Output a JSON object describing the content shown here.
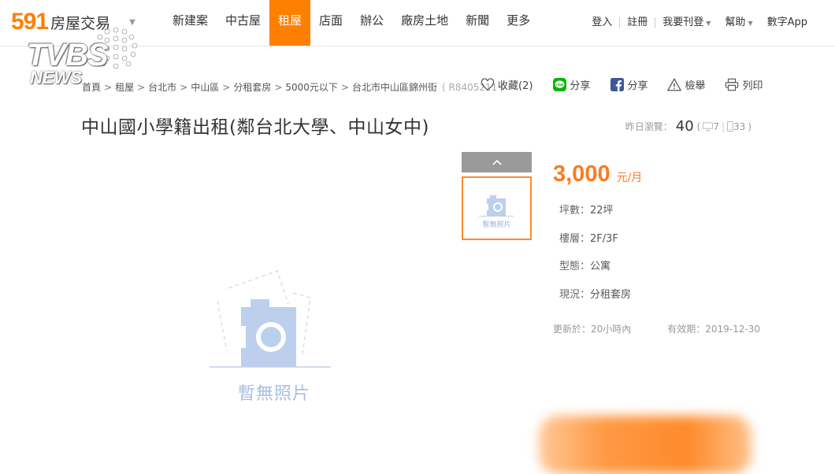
{
  "header": {
    "logo_num": "591",
    "logo_text": "房屋交易",
    "nav": [
      {
        "label": "新建案",
        "active": false
      },
      {
        "label": "中古屋",
        "active": false
      },
      {
        "label": "租屋",
        "active": true
      },
      {
        "label": "店面",
        "active": false
      },
      {
        "label": "辦公",
        "active": false
      },
      {
        "label": "廠房土地",
        "active": false
      },
      {
        "label": "新聞",
        "active": false
      },
      {
        "label": "更多",
        "active": false
      }
    ],
    "right": {
      "login": "登入",
      "register": "註冊",
      "post": "我要刊登",
      "help": "幫助",
      "app": "數字App"
    }
  },
  "watermark": {
    "main": "TVBS",
    "sub": "NEWS"
  },
  "breadcrumb": {
    "items": [
      "首頁",
      "租屋",
      "台北市",
      "中山區",
      "分租套房",
      "5000元以下",
      "台北市中山區錦州街"
    ],
    "code": "( R8405211 )"
  },
  "actions": {
    "favorite": "收藏(2)",
    "line_share": "分享",
    "fb_share": "分享",
    "report": "檢舉",
    "print": "列印"
  },
  "listing": {
    "title": "中山國小學籍出租(鄰台北大學、中山女中)",
    "views_label": "昨日瀏覽：",
    "views_total": "40",
    "views_open": "(",
    "views_desktop": "7",
    "views_mobile": "33",
    "views_close": ")",
    "no_photo": "暫無照片",
    "price": "3,000",
    "price_unit": "元/月",
    "attrs": [
      {
        "key": "坪數：",
        "value": "22坪"
      },
      {
        "key": "樓層：",
        "value": "2F/3F"
      },
      {
        "key": "型態：",
        "value": "公寓"
      },
      {
        "key": "現況：",
        "value": "分租套房"
      }
    ],
    "updated": "更新於：20小時內",
    "valid_until": "有效期：2019-12-30"
  },
  "colors": {
    "brand": "#ff8000",
    "price": "#ff7a1f",
    "placeholder": "#a9bfe0"
  }
}
